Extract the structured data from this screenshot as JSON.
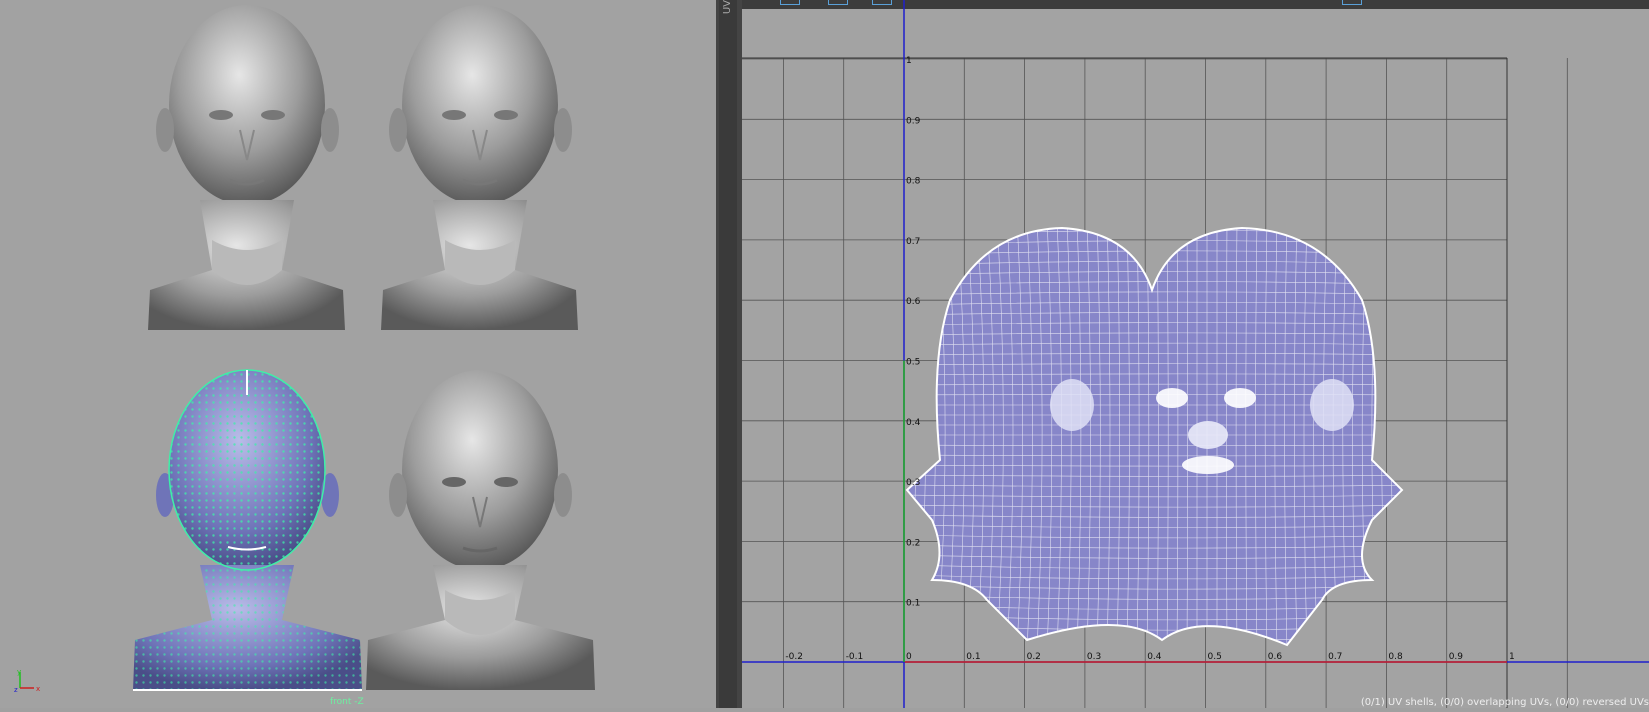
{
  "uv_editor": {
    "tab_label": "UV",
    "status_text": "(0/1) UV shells, (0/0) overlapping UVs, (0/0) reversed UVs"
  },
  "viewport": {
    "camera_label": "front -Z"
  },
  "axis_gizmo": {
    "y_label": "y",
    "x_label": "x",
    "z_label": "z"
  },
  "grid": {
    "u_ticks": [
      "-0.2",
      "-0.1",
      "0",
      "0.1",
      "0.2",
      "0.3",
      "0.4",
      "0.5",
      "0.6",
      "0.7",
      "0.8",
      "0.9",
      "1"
    ],
    "v_ticks": [
      "0.1",
      "0.2",
      "0.3",
      "0.4",
      "0.5",
      "0.6",
      "0.7",
      "0.8",
      "0.9",
      "1"
    ]
  },
  "colors": {
    "uv_shell_fill": "#8786c9",
    "wire_green": "#3df0a8",
    "u_axis": "#cc2020",
    "v_axis": "#20b020",
    "axis_blue": "#2020cc"
  }
}
